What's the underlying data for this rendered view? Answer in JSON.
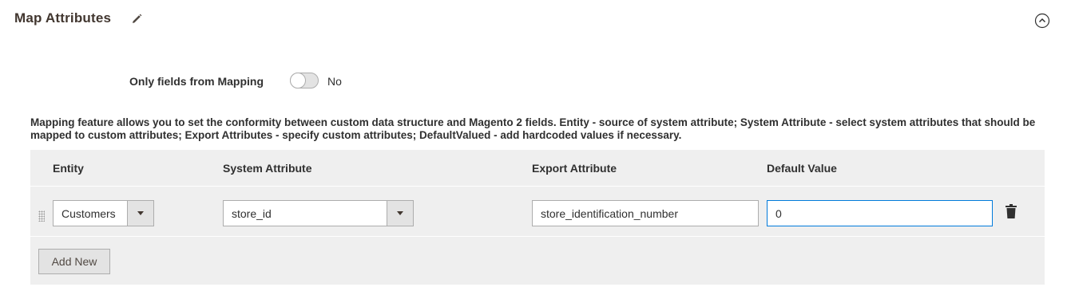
{
  "section": {
    "title": "Map Attributes",
    "edit_icon": "pencil-icon",
    "collapse_icon": "chevron-up-circle-icon"
  },
  "mapping_toggle": {
    "label": "Only fields from Mapping",
    "value": "No",
    "enabled": false
  },
  "description": "Mapping feature allows you to set the conformity between custom data structure and Magento 2 fields. Entity - source of system attribute; System Attribute - select system attributes that should be mapped to custom attributes; Export Attributes - specify custom attributes; DefaultValued - add hardcoded values if necessary.",
  "grid": {
    "columns": [
      "Entity",
      "System Attribute",
      "Export Attribute",
      "Default Value"
    ],
    "rows": [
      {
        "entity": "Customers",
        "system_attribute": "store_id",
        "export_attribute": "store_identification_number",
        "default_value": "0"
      }
    ],
    "add_button_label": "Add New"
  },
  "colors": {
    "focus_border": "#007bdb",
    "grid_background": "#efefef",
    "button_background": "#e3e3e3"
  }
}
